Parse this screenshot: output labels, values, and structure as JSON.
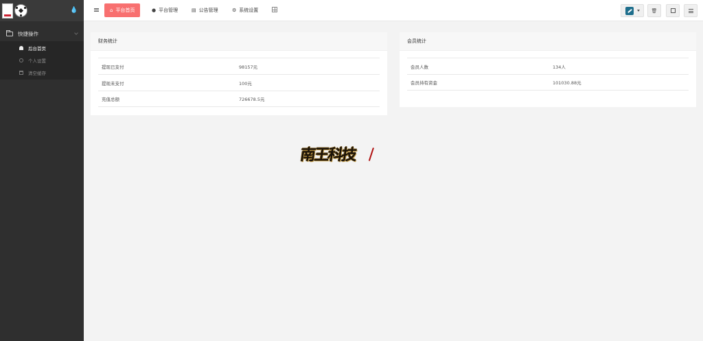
{
  "sidebar": {
    "group_label": "快捷操作",
    "items": [
      {
        "label": "后台首页",
        "active": true,
        "icon": "home-icon"
      },
      {
        "label": "个人设置",
        "active": false,
        "icon": "user-icon"
      },
      {
        "label": "清空缓存",
        "active": false,
        "icon": "trash-icon"
      }
    ]
  },
  "topbar": {
    "tabs": [
      {
        "label": "平台首页",
        "icon": "home-icon",
        "active": true
      },
      {
        "label": "平台管理",
        "icon": "user-icon",
        "active": false
      },
      {
        "label": "公告管理",
        "icon": "card-icon",
        "active": false
      },
      {
        "label": "系统设置",
        "icon": "gear-icon",
        "active": false
      }
    ]
  },
  "finance": {
    "title": "财务统计",
    "rows": [
      {
        "label": "提现已支付",
        "value": "98157元"
      },
      {
        "label": "提现未支付",
        "value": "100元"
      },
      {
        "label": "充值总额",
        "value": "726678.5元"
      }
    ]
  },
  "members": {
    "title": "会员统计",
    "rows": [
      {
        "label": "会员人数",
        "value": "134人"
      },
      {
        "label": "会员持有资金",
        "value": "101030.88元"
      }
    ]
  },
  "watermark": {
    "text": "南王科技"
  },
  "colors": {
    "accent": "#f87070",
    "sidebar": "#2f2f2f",
    "theme": "#1e6e8c"
  }
}
